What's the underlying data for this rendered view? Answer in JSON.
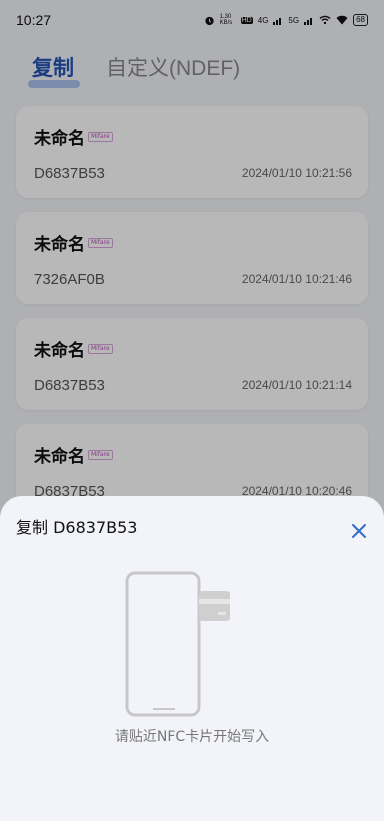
{
  "status_bar": {
    "time": "10:27",
    "net_speed": "1.30 KB/s",
    "hd_label": "HD",
    "net_4g": "4G",
    "net_5g": "5G",
    "battery": "68"
  },
  "tabs": [
    {
      "label": "复制",
      "active": true
    },
    {
      "label": "自定义(NDEF)",
      "active": false
    }
  ],
  "cards": [
    {
      "title": "未命名",
      "badge": "Mifare",
      "uid": "D6837B53",
      "time": "2024/01/10 10:21:56"
    },
    {
      "title": "未命名",
      "badge": "Mifare",
      "uid": "7326AF0B",
      "time": "2024/01/10 10:21:46"
    },
    {
      "title": "未命名",
      "badge": "Mifare",
      "uid": "D6837B53",
      "time": "2024/01/10 10:21:14"
    },
    {
      "title": "未命名",
      "badge": "Mifare",
      "uid": "D6837B53",
      "time": "2024/01/10 10:20:46"
    }
  ],
  "sheet": {
    "title": "复制 D6837B53",
    "hint": "请贴近NFC卡片开始写入",
    "close_icon": "close-icon",
    "accent": "#2f6ecf"
  }
}
